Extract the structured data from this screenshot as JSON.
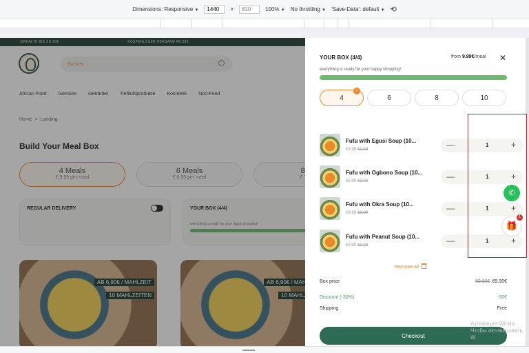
{
  "devtools": {
    "dimensions_label": "Dimensions: Responsive",
    "width": "1440",
    "times": "×",
    "height": "810",
    "zoom": "100%",
    "throttling": "No throttling",
    "save_data": "'Save-Data': default"
  },
  "promo": {
    "left": "ERHALTE BIS ZU 20€",
    "right": "KOSTENLOSER VERSAND AB 59€"
  },
  "search": {
    "placeholder": "Suchen"
  },
  "nav": [
    "African Food",
    "Gemüse",
    "Getränke",
    "Tiefkühlprodukte",
    "Kosmetik",
    "Non-Food"
  ],
  "breadcrumb": {
    "home": "Home",
    "sep": ">",
    "current": "Landing"
  },
  "page_title": "Build Your Meal Box",
  "meal_options": [
    {
      "label": "4 Meals",
      "price": "€ 9.99 per meal"
    },
    {
      "label": "6 Meals",
      "price": "€ 8.99 per meal"
    },
    {
      "label": "8 M",
      "price": "€ 7.99"
    }
  ],
  "cards": {
    "delivery": "REGULAR DELIVERY",
    "box": "YOUR BOX (4/4)",
    "box_sub": "everything is ready for your happy shopping!"
  },
  "food_tags": [
    {
      "price": "AB 6,90€ / MAHLZEIT",
      "count": "10 MAHLZEITEN"
    },
    {
      "price": "AB 6,90€ / MAHLZ",
      "count": "10 MAHLZEI"
    }
  ],
  "panel": {
    "title": "YOUR BOX (4/4)",
    "from_label": "from",
    "from_price": "9.99€",
    "from_unit": "/meal",
    "close": "✕",
    "subtitle": "everything is ready for your happy shopping!",
    "progress": 1.0,
    "sizes": [
      "4",
      "6",
      "8",
      "10"
    ],
    "items": [
      {
        "name": "Fufu with Egusi Soup (10...",
        "price": "€9.99",
        "old_price": "€9.99",
        "qty": "1"
      },
      {
        "name": "Fufu with Ogbono Soup (10...",
        "price": "€9.99",
        "old_price": "€9.99",
        "qty": "1"
      },
      {
        "name": "Fufu with Okra Soup (10...",
        "price": "€9.99",
        "old_price": "€9.99",
        "qty": "1"
      },
      {
        "name": "Fufu with Peanut Soup (10...",
        "price": "€9.99",
        "old_price": "€9.99",
        "qty": "1"
      }
    ],
    "remove_all": "Remove all",
    "box_price_label": "Box price",
    "box_price_old": "99.90€",
    "box_price": "69.90€",
    "discount_label": "Discount (-30%)",
    "discount": "-30€",
    "shipping_label": "Shipping",
    "shipping": "Free",
    "checkout": "Checkout"
  },
  "gift_badge": "1",
  "windows_watermark": {
    "line1": "Активация Windo",
    "line2": "Чтобы активировать W"
  }
}
